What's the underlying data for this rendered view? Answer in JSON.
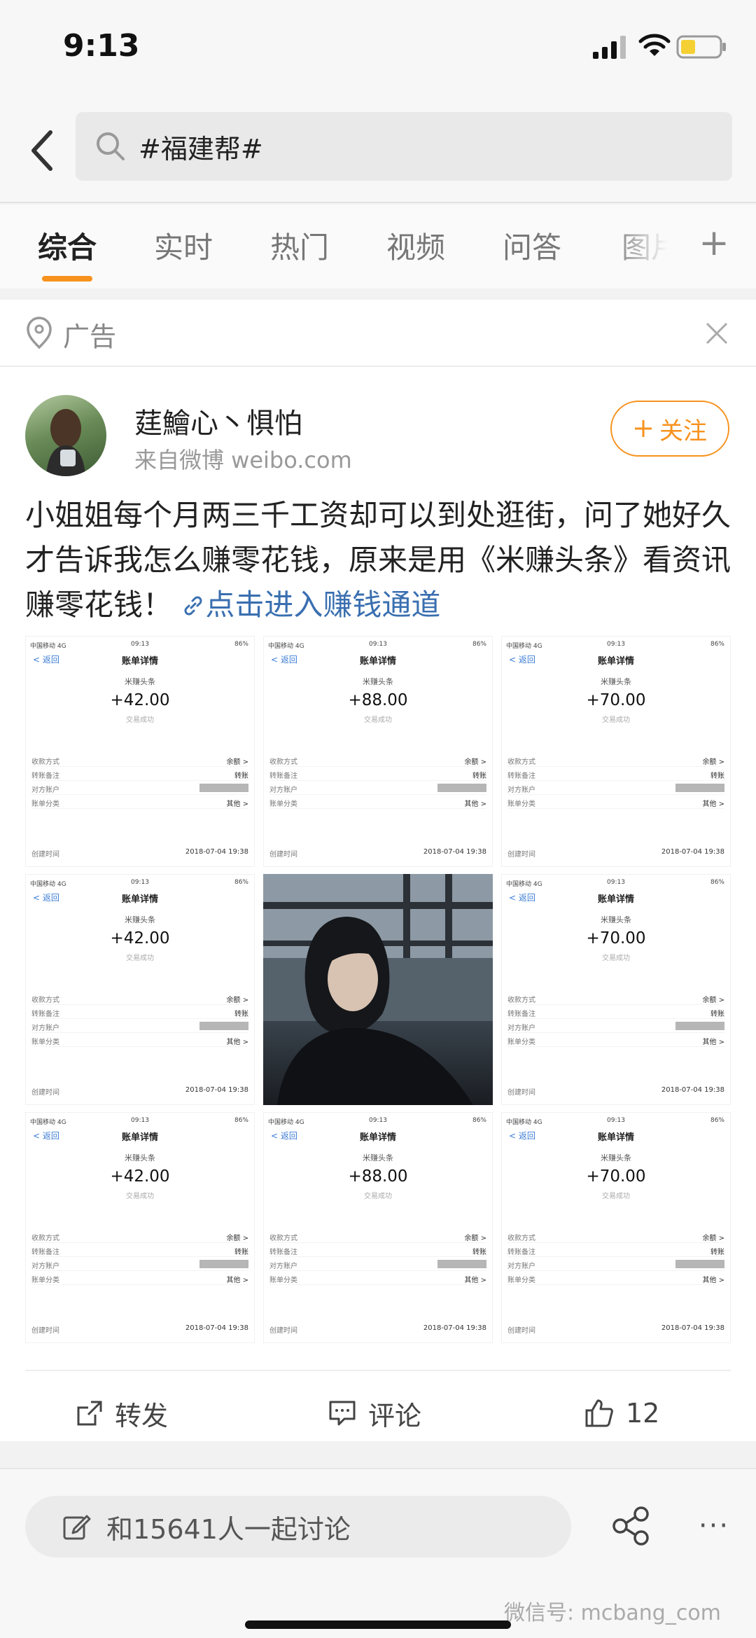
{
  "status_bar": {
    "time": "9:13"
  },
  "search": {
    "query": "#福建帮#"
  },
  "tabs": [
    {
      "label": "综合"
    },
    {
      "label": "实时"
    },
    {
      "label": "热门"
    },
    {
      "label": "视频"
    },
    {
      "label": "问答"
    },
    {
      "label": "图片"
    }
  ],
  "ad": {
    "label": "广告"
  },
  "post": {
    "username": "莛鱠心丶惧怕",
    "source": "来自微博 weibo.com",
    "follow_label": "关注",
    "text": "小姐姐每个月两三千工资却可以到处逛街，问了她好久才告诉我怎么赚零花钱，原来是用《米赚头条》看资讯赚零花钱！",
    "link_text": "点击进入赚钱通道"
  },
  "receipt_common": {
    "carrier": "中国移动 4G",
    "time": "09:13",
    "battery": "86%",
    "back": "返回",
    "title": "账单详情",
    "merchant": "米赚头条",
    "status": "交易成功",
    "rows": [
      {
        "label": "收款方式",
        "value": "余额 >"
      },
      {
        "label": "转账备注",
        "value": "转账"
      },
      {
        "label": "对方账户",
        "value": ""
      },
      {
        "label": "账单分类",
        "value": "其他 >"
      }
    ],
    "created_label": "创建时间",
    "created_value": "2018-07-04 19:38"
  },
  "receipts": [
    {
      "amount": "+42.00"
    },
    {
      "amount": "+88.00"
    },
    {
      "amount": "+70.00"
    },
    {
      "amount": "+42.00"
    },
    {
      "amount": ""
    },
    {
      "amount": "+70.00"
    },
    {
      "amount": "+42.00"
    },
    {
      "amount": "+88.00"
    },
    {
      "amount": "+70.00"
    }
  ],
  "actions": {
    "repost": "转发",
    "comment": "评论",
    "like_count": "12"
  },
  "bottom": {
    "discuss_placeholder": "和15641人一起讨论",
    "watermark": "微信号: mcbang_com"
  },
  "colors": {
    "accent": "#f7921e",
    "link": "#3a6fb0"
  }
}
